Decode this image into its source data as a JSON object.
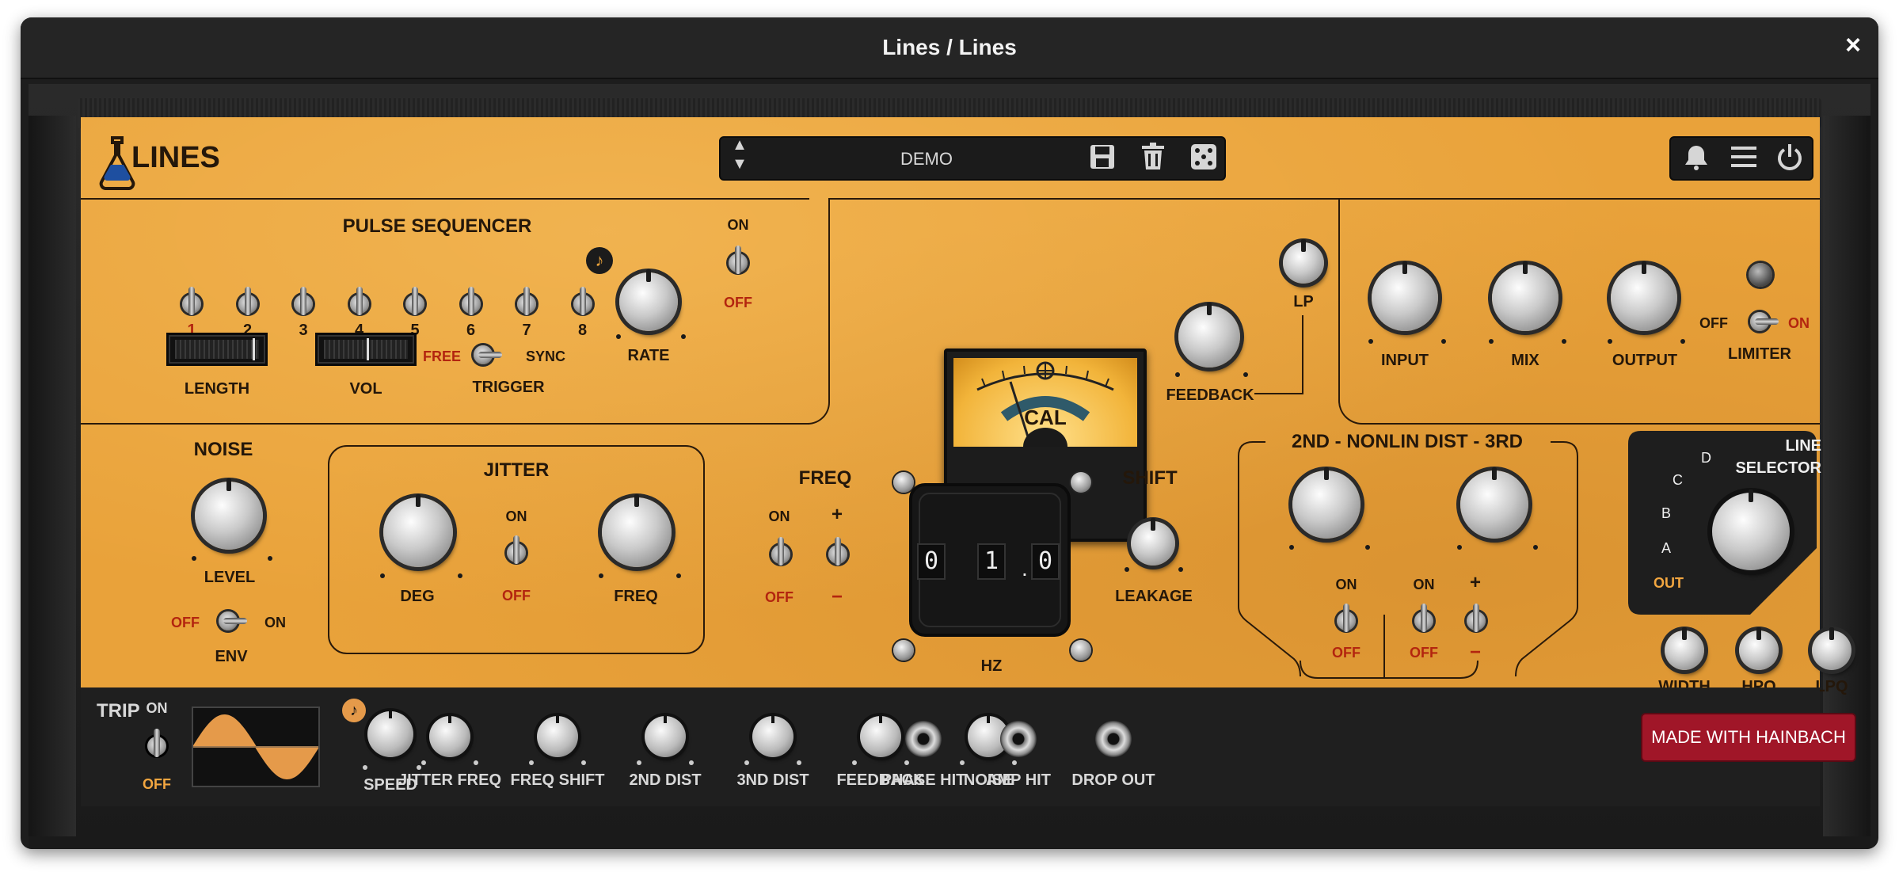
{
  "window": {
    "title": "Lines / Lines",
    "close": "×"
  },
  "brand": {
    "name": "LINES"
  },
  "preset": {
    "name": "DEMO"
  },
  "pulse": {
    "title": "PULSE SEQUENCER",
    "steps": [
      "1",
      "2",
      "3",
      "4",
      "5",
      "6",
      "7",
      "8"
    ],
    "length": "LENGTH",
    "vol": "VOL",
    "free": "FREE",
    "sync": "SYNC",
    "trigger": "TRIGGER",
    "rate": "RATE",
    "on": "ON",
    "off": "OFF",
    "note": "♪"
  },
  "delay": {
    "cal": "CAL",
    "feedback": "FEEDBACK",
    "lp": "LP"
  },
  "master": {
    "input": "INPUT",
    "mix": "MIX",
    "output": "OUTPUT",
    "off": "OFF",
    "on": "ON",
    "limiter": "LIMITER"
  },
  "noise": {
    "title": "NOISE",
    "level": "LEVEL",
    "off": "OFF",
    "on": "ON",
    "env": "ENV"
  },
  "jitter": {
    "title": "JITTER",
    "deg": "DEG",
    "on": "ON",
    "off": "OFF",
    "freq": "FREQ"
  },
  "shift": {
    "freq": "FREQ",
    "shift": "SHIFT",
    "on": "ON",
    "off": "OFF",
    "plus": "+",
    "minus": "−",
    "digits": [
      "0",
      "1",
      "0"
    ],
    "hz": "HZ",
    "leakage": "LEAKAGE",
    "sep": "."
  },
  "nonlin": {
    "title": "2ND - NONLIN DIST - 3RD",
    "on1": "ON",
    "off1": "OFF",
    "on2": "ON",
    "off2": "OFF",
    "plus": "+",
    "minus": "−"
  },
  "line": {
    "title1": "LINE",
    "title2": "SELECTOR",
    "d": "D",
    "c": "C",
    "b": "B",
    "a": "A",
    "out": "OUT",
    "width": "WIDTH",
    "hpq": "HPQ",
    "lpq": "LPQ"
  },
  "trip": {
    "title": "TRIP",
    "on": "ON",
    "off": "OFF",
    "speed": "SPEED",
    "knobs": [
      "JITTER FREQ",
      "FREQ SHIFT",
      "2ND DIST",
      "3ND DIST",
      "FEEDBACK",
      "NOISE"
    ],
    "hits": [
      "PHASE HIT",
      "AMP HIT",
      "DROP OUT"
    ],
    "made": "MADE WITH HAINBACH",
    "note": "♪"
  },
  "colors": {
    "panel": "#e9a23a",
    "ink": "#24170a",
    "red": "#b3250f",
    "dark": "#1f1f1f",
    "made": "#a01628",
    "wave": "#e59a4a"
  }
}
